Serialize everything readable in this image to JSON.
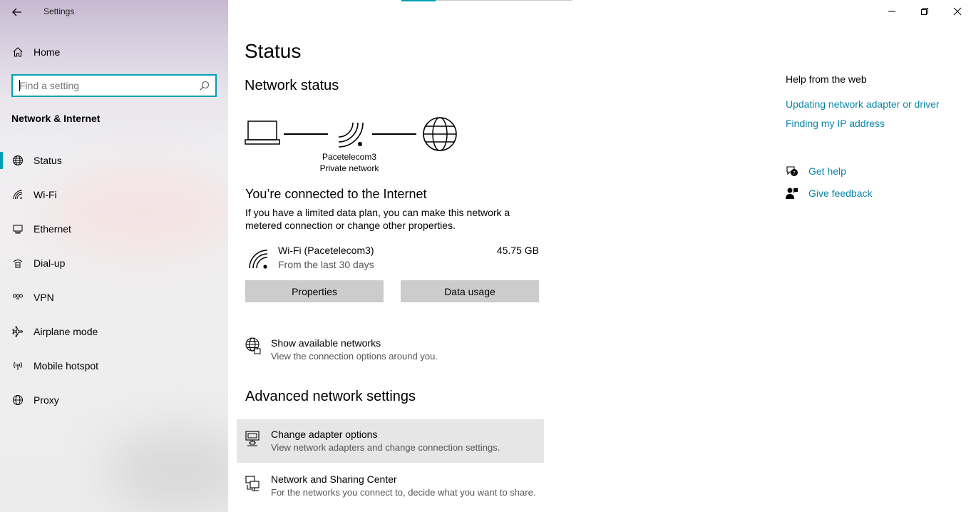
{
  "window": {
    "title": "Settings"
  },
  "sidebar": {
    "home_label": "Home",
    "search_placeholder": "Find a setting",
    "section_title": "Network & Internet",
    "items": [
      {
        "label": "Status",
        "icon": "globe-icon",
        "selected": true
      },
      {
        "label": "Wi-Fi",
        "icon": "wifi-icon",
        "selected": false
      },
      {
        "label": "Ethernet",
        "icon": "ethernet-icon",
        "selected": false
      },
      {
        "label": "Dial-up",
        "icon": "dialup-icon",
        "selected": false
      },
      {
        "label": "VPN",
        "icon": "vpn-icon",
        "selected": false
      },
      {
        "label": "Airplane mode",
        "icon": "airplane-icon",
        "selected": false
      },
      {
        "label": "Mobile hotspot",
        "icon": "hotspot-icon",
        "selected": false
      },
      {
        "label": "Proxy",
        "icon": "globe-icon",
        "selected": false
      }
    ]
  },
  "main": {
    "title": "Status",
    "network_status_header": "Network status",
    "diagram": {
      "network_name": "Pacetelecom3",
      "network_type": "Private network"
    },
    "connected_title": "You’re connected to the Internet",
    "connected_desc": "If you have a limited data plan, you can make this network a metered connection or change other properties.",
    "connection": {
      "name": "Wi-Fi (Pacetelecom3)",
      "period": "From the last 30 days",
      "usage": "45.75 GB"
    },
    "buttons": {
      "properties": "Properties",
      "data_usage": "Data usage"
    },
    "show_networks": {
      "title": "Show available networks",
      "desc": "View the connection options around you."
    },
    "advanced_header": "Advanced network settings",
    "change_adapter": {
      "title": "Change adapter options",
      "desc": "View network adapters and change connection settings."
    },
    "sharing_center": {
      "title": "Network and Sharing Center",
      "desc": "For the networks you connect to, decide what you want to share."
    }
  },
  "help": {
    "title": "Help from the web",
    "links": [
      "Updating network adapter or driver",
      "Finding my IP address"
    ],
    "get_help": "Get help",
    "give_feedback": "Give feedback"
  },
  "colors": {
    "accent": "#00a1b3",
    "link": "#0a86a8"
  }
}
